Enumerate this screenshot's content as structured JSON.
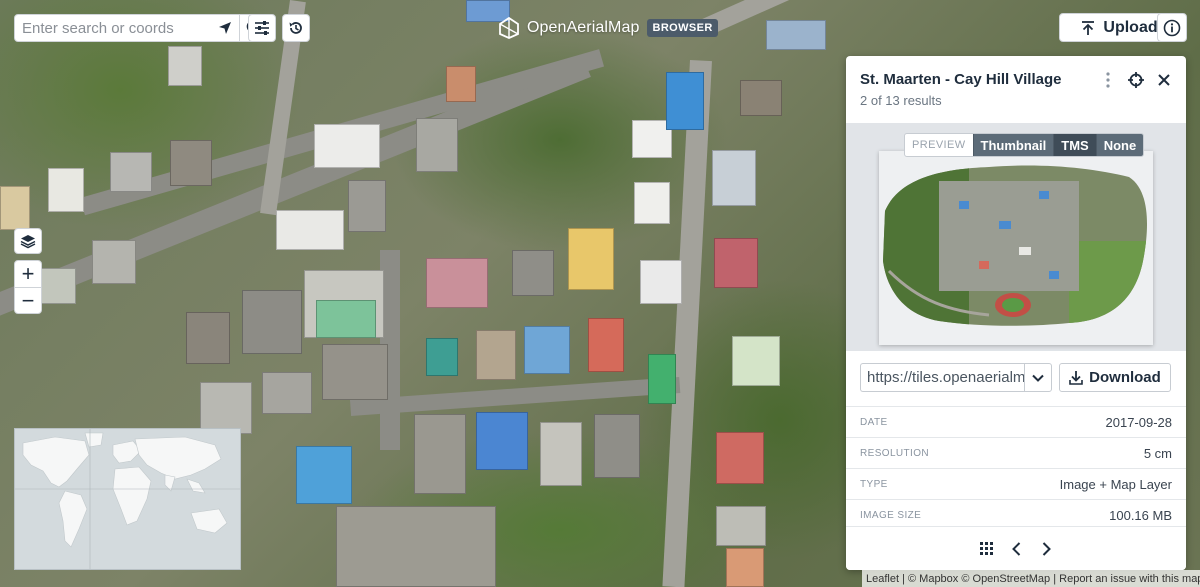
{
  "app": {
    "name": "OpenAerialMap",
    "badge": "BROWSER"
  },
  "search": {
    "placeholder": "Enter search or coords",
    "value": ""
  },
  "toolbar": {
    "locate_icon": "location-arrow-icon",
    "search_icon": "search-icon",
    "filter_icon": "sliders-icon",
    "history_icon": "history-icon"
  },
  "header": {
    "upload_label": "Upload",
    "info_icon": "info-icon"
  },
  "map_controls": {
    "layers_icon": "layers-icon",
    "zoom_in": "+",
    "zoom_out": "−"
  },
  "panel": {
    "title": "St. Maarten - Cay Hill Village",
    "subtitle": "2 of 13 results",
    "preview": {
      "label": "PREVIEW",
      "options": [
        "Thumbnail",
        "TMS",
        "None"
      ],
      "selected": "TMS"
    },
    "url_value": "https://tiles.openaerialmap.org",
    "download_label": "Download",
    "meta": [
      {
        "key": "DATE",
        "value": "2017-09-28"
      },
      {
        "key": "RESOLUTION",
        "value": "5 cm"
      },
      {
        "key": "TYPE",
        "value": "Image + Map Layer"
      },
      {
        "key": "IMAGE SIZE",
        "value": "100.16 MB"
      }
    ]
  },
  "attribution": "Leaflet | © Mapbox © OpenStreetMap | Report an issue with this map",
  "colors": {
    "accent": "#1f2d3d",
    "badge": "#4c5b6a",
    "toggle_active": "#3f4c58",
    "toggle": "#5c6b78"
  }
}
